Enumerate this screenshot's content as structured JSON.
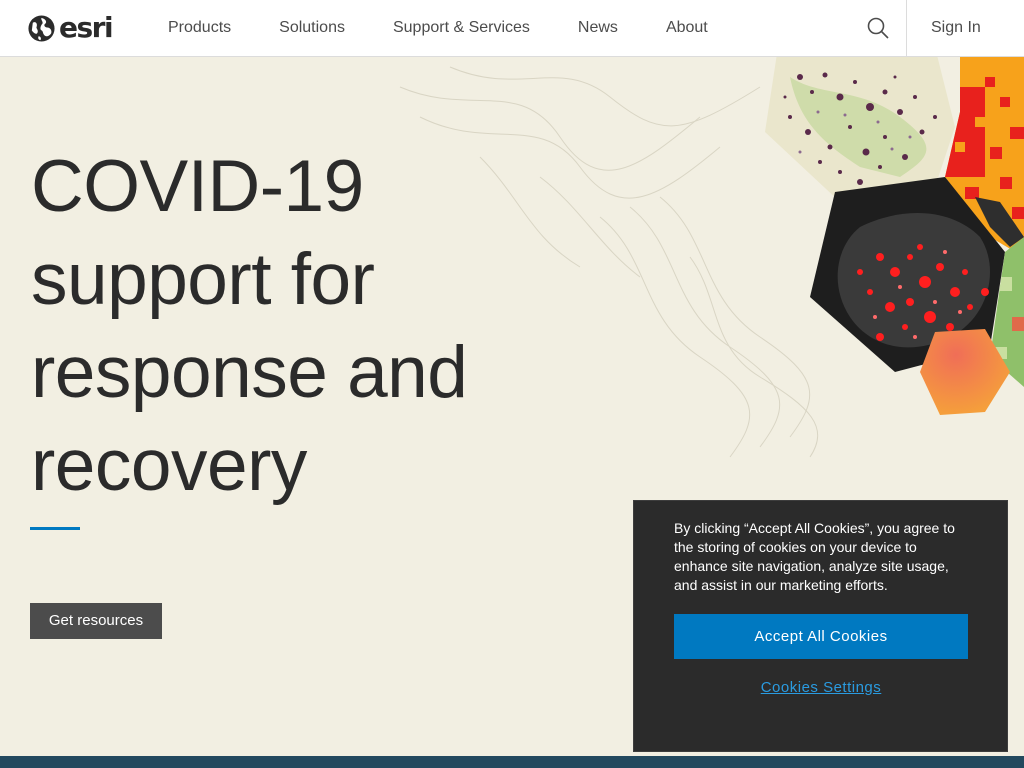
{
  "header": {
    "logo_text": "esri",
    "nav": [
      {
        "label": "Products"
      },
      {
        "label": "Solutions"
      },
      {
        "label": "Support & Services"
      },
      {
        "label": "News"
      },
      {
        "label": "About"
      }
    ],
    "search_icon": "search-icon",
    "signin_label": "Sign In"
  },
  "hero": {
    "title_lines": [
      "COVID-19",
      "support for",
      "response and",
      "recovery"
    ],
    "cta_label": "Get resources"
  },
  "cookie_banner": {
    "text": "By clicking “Accept All Cookies”, you agree to the storing of cookies on your device to enhance site navigation, analyze site usage, and assist in our marketing efforts.",
    "accept_label": "Accept All Cookies",
    "settings_label": "Cookies Settings"
  },
  "colors": {
    "background": "#f2efe2",
    "accent_blue": "#0079c1",
    "cta_gray": "#4c4c4c",
    "cookie_bg": "#2b2b2b",
    "footer_bar": "#23495e"
  }
}
